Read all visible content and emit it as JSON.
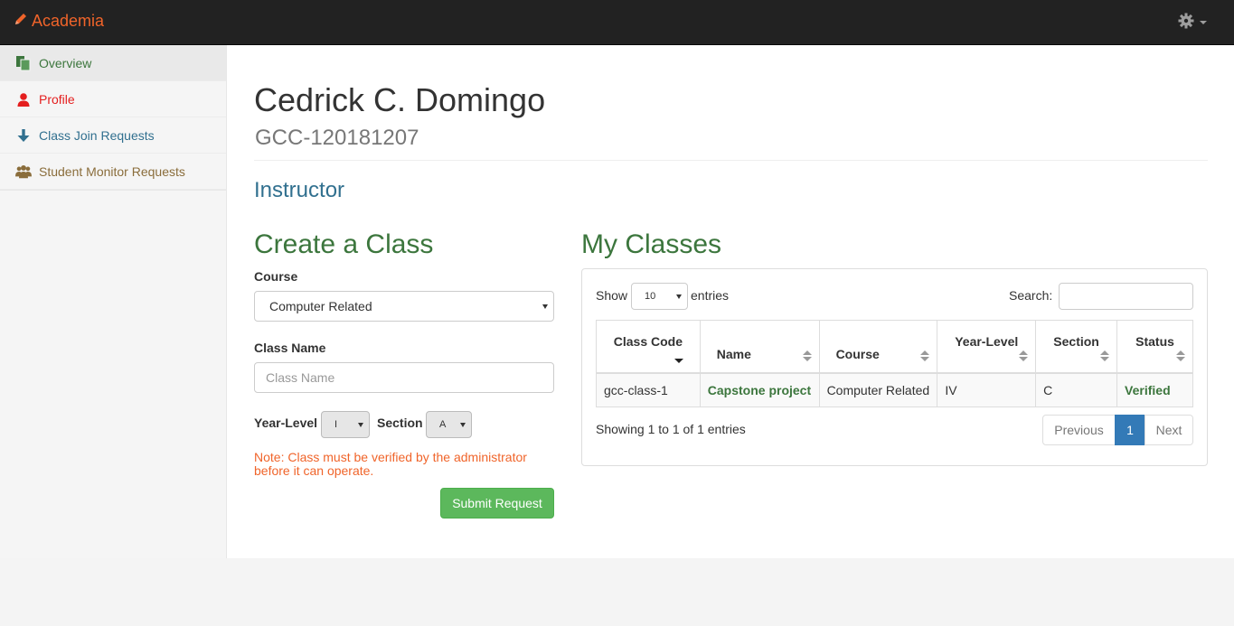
{
  "navbar": {
    "brand": "Academia",
    "brand_icon": "pencil-icon",
    "settings_icon": "gear-icon"
  },
  "sidebar": {
    "items": [
      {
        "label": "Overview",
        "icon": "overview-icon",
        "color": "#3c763d"
      },
      {
        "label": "Profile",
        "icon": "user-icon",
        "color": "#e41e1e"
      },
      {
        "label": "Class Join Requests",
        "icon": "arrow-down-icon",
        "color": "#31708f"
      },
      {
        "label": "Student Monitor Requests",
        "icon": "users-icon",
        "color": "#8a6d3b"
      }
    ]
  },
  "profile": {
    "name": "Cedrick C. Domingo",
    "id": "GCC-120181207",
    "role": "Instructor"
  },
  "create_class": {
    "heading": "Create a Class",
    "course_label": "Course",
    "course_value": "Computer Related",
    "class_name_label": "Class Name",
    "class_name_placeholder": "Class Name",
    "year_level_label": "Year-Level",
    "year_level_value": "I",
    "section_label": "Section",
    "section_value": "A",
    "note": "Note: Class must be verified by the administrator before it can operate.",
    "submit_label": "Submit Request"
  },
  "my_classes": {
    "heading": "My Classes",
    "show_label": "Show",
    "entries_value": "10",
    "entries_label": "entries",
    "search_label": "Search:",
    "columns": [
      "Class Code",
      "Name",
      "Course",
      "Year-Level",
      "Section",
      "Status"
    ],
    "rows": [
      {
        "code": "gcc-class-1",
        "name": "Capstone project",
        "course": "Computer Related",
        "year": "IV",
        "section": "C",
        "status": "Verified"
      }
    ],
    "info": "Showing 1 to 1 of 1 entries",
    "pagination": {
      "previous": "Previous",
      "current": "1",
      "next": "Next"
    }
  }
}
